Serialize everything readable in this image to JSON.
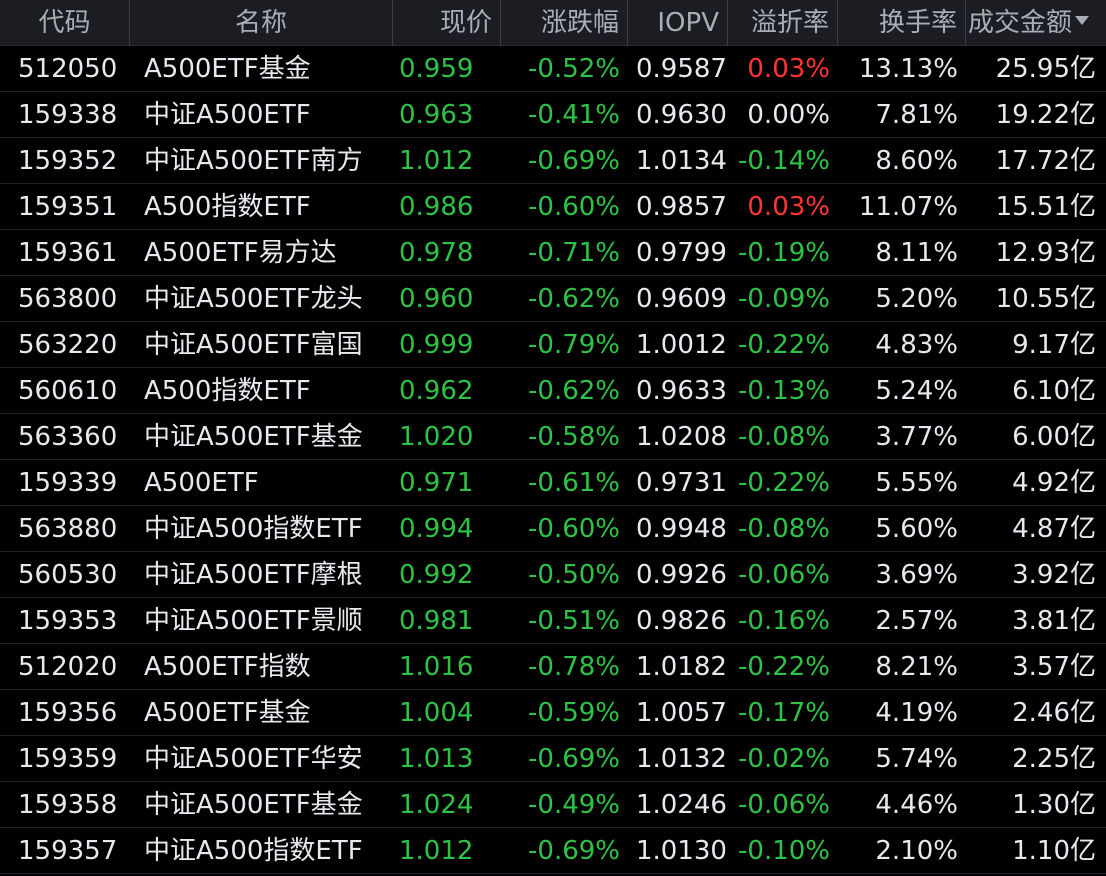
{
  "colors": {
    "background": "#000000",
    "header_bg": "#1b1d22",
    "up": "#ff3434",
    "down": "#2ec346",
    "neutral": "#e7e9ee"
  },
  "header": {
    "code": "代码",
    "name": "名称",
    "price": "现价",
    "change": "涨跌幅",
    "iopv": "IOPV",
    "premium": "溢折率",
    "turnover": "换手率",
    "amount": "成交金额"
  },
  "rows": [
    {
      "code": "512050",
      "name": "A500ETF基金",
      "price": "0.959",
      "change": "-0.52%",
      "iopv": "0.9587",
      "premium": "0.03%",
      "premium_dir": "up",
      "turnover": "13.13%",
      "amount": "25.95亿"
    },
    {
      "code": "159338",
      "name": "中证A500ETF",
      "price": "0.963",
      "change": "-0.41%",
      "iopv": "0.9630",
      "premium": "0.00%",
      "premium_dir": "flat",
      "turnover": "7.81%",
      "amount": "19.22亿"
    },
    {
      "code": "159352",
      "name": "中证A500ETF南方",
      "price": "1.012",
      "change": "-0.69%",
      "iopv": "1.0134",
      "premium": "-0.14%",
      "premium_dir": "down",
      "turnover": "8.60%",
      "amount": "17.72亿"
    },
    {
      "code": "159351",
      "name": "A500指数ETF",
      "price": "0.986",
      "change": "-0.60%",
      "iopv": "0.9857",
      "premium": "0.03%",
      "premium_dir": "up",
      "turnover": "11.07%",
      "amount": "15.51亿"
    },
    {
      "code": "159361",
      "name": "A500ETF易方达",
      "price": "0.978",
      "change": "-0.71%",
      "iopv": "0.9799",
      "premium": "-0.19%",
      "premium_dir": "down",
      "turnover": "8.11%",
      "amount": "12.93亿"
    },
    {
      "code": "563800",
      "name": "中证A500ETF龙头",
      "price": "0.960",
      "change": "-0.62%",
      "iopv": "0.9609",
      "premium": "-0.09%",
      "premium_dir": "down",
      "turnover": "5.20%",
      "amount": "10.55亿"
    },
    {
      "code": "563220",
      "name": "中证A500ETF富国",
      "price": "0.999",
      "change": "-0.79%",
      "iopv": "1.0012",
      "premium": "-0.22%",
      "premium_dir": "down",
      "turnover": "4.83%",
      "amount": "9.17亿"
    },
    {
      "code": "560610",
      "name": "A500指数ETF",
      "price": "0.962",
      "change": "-0.62%",
      "iopv": "0.9633",
      "premium": "-0.13%",
      "premium_dir": "down",
      "turnover": "5.24%",
      "amount": "6.10亿"
    },
    {
      "code": "563360",
      "name": "中证A500ETF基金",
      "price": "1.020",
      "change": "-0.58%",
      "iopv": "1.0208",
      "premium": "-0.08%",
      "premium_dir": "down",
      "turnover": "3.77%",
      "amount": "6.00亿"
    },
    {
      "code": "159339",
      "name": "A500ETF",
      "price": "0.971",
      "change": "-0.61%",
      "iopv": "0.9731",
      "premium": "-0.22%",
      "premium_dir": "down",
      "turnover": "5.55%",
      "amount": "4.92亿"
    },
    {
      "code": "563880",
      "name": "中证A500指数ETF",
      "price": "0.994",
      "change": "-0.60%",
      "iopv": "0.9948",
      "premium": "-0.08%",
      "premium_dir": "down",
      "turnover": "5.60%",
      "amount": "4.87亿"
    },
    {
      "code": "560530",
      "name": "中证A500ETF摩根",
      "price": "0.992",
      "change": "-0.50%",
      "iopv": "0.9926",
      "premium": "-0.06%",
      "premium_dir": "down",
      "turnover": "3.69%",
      "amount": "3.92亿"
    },
    {
      "code": "159353",
      "name": "中证A500ETF景顺",
      "price": "0.981",
      "change": "-0.51%",
      "iopv": "0.9826",
      "premium": "-0.16%",
      "premium_dir": "down",
      "turnover": "2.57%",
      "amount": "3.81亿"
    },
    {
      "code": "512020",
      "name": "A500ETF指数",
      "price": "1.016",
      "change": "-0.78%",
      "iopv": "1.0182",
      "premium": "-0.22%",
      "premium_dir": "down",
      "turnover": "8.21%",
      "amount": "3.57亿"
    },
    {
      "code": "159356",
      "name": "A500ETF基金",
      "price": "1.004",
      "change": "-0.59%",
      "iopv": "1.0057",
      "premium": "-0.17%",
      "premium_dir": "down",
      "turnover": "4.19%",
      "amount": "2.46亿"
    },
    {
      "code": "159359",
      "name": "中证A500ETF华安",
      "price": "1.013",
      "change": "-0.69%",
      "iopv": "1.0132",
      "premium": "-0.02%",
      "premium_dir": "down",
      "turnover": "5.74%",
      "amount": "2.25亿"
    },
    {
      "code": "159358",
      "name": "中证A500ETF基金",
      "price": "1.024",
      "change": "-0.49%",
      "iopv": "1.0246",
      "premium": "-0.06%",
      "premium_dir": "down",
      "turnover": "4.46%",
      "amount": "1.30亿"
    },
    {
      "code": "159357",
      "name": "中证A500指数ETF",
      "price": "1.012",
      "change": "-0.69%",
      "iopv": "1.0130",
      "premium": "-0.10%",
      "premium_dir": "down",
      "turnover": "2.10%",
      "amount": "1.10亿"
    }
  ]
}
